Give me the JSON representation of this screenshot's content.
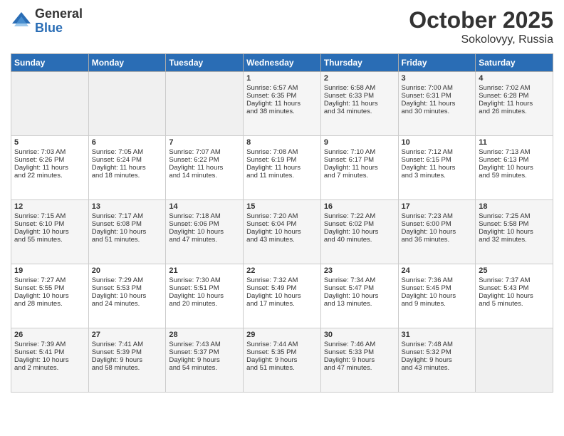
{
  "logo": {
    "general": "General",
    "blue": "Blue"
  },
  "header": {
    "month": "October 2025",
    "location": "Sokolovyy, Russia"
  },
  "weekdays": [
    "Sunday",
    "Monday",
    "Tuesday",
    "Wednesday",
    "Thursday",
    "Friday",
    "Saturday"
  ],
  "weeks": [
    [
      {
        "day": "",
        "info": ""
      },
      {
        "day": "",
        "info": ""
      },
      {
        "day": "",
        "info": ""
      },
      {
        "day": "1",
        "info": "Sunrise: 6:57 AM\nSunset: 6:35 PM\nDaylight: 11 hours\nand 38 minutes."
      },
      {
        "day": "2",
        "info": "Sunrise: 6:58 AM\nSunset: 6:33 PM\nDaylight: 11 hours\nand 34 minutes."
      },
      {
        "day": "3",
        "info": "Sunrise: 7:00 AM\nSunset: 6:31 PM\nDaylight: 11 hours\nand 30 minutes."
      },
      {
        "day": "4",
        "info": "Sunrise: 7:02 AM\nSunset: 6:28 PM\nDaylight: 11 hours\nand 26 minutes."
      }
    ],
    [
      {
        "day": "5",
        "info": "Sunrise: 7:03 AM\nSunset: 6:26 PM\nDaylight: 11 hours\nand 22 minutes."
      },
      {
        "day": "6",
        "info": "Sunrise: 7:05 AM\nSunset: 6:24 PM\nDaylight: 11 hours\nand 18 minutes."
      },
      {
        "day": "7",
        "info": "Sunrise: 7:07 AM\nSunset: 6:22 PM\nDaylight: 11 hours\nand 14 minutes."
      },
      {
        "day": "8",
        "info": "Sunrise: 7:08 AM\nSunset: 6:19 PM\nDaylight: 11 hours\nand 11 minutes."
      },
      {
        "day": "9",
        "info": "Sunrise: 7:10 AM\nSunset: 6:17 PM\nDaylight: 11 hours\nand 7 minutes."
      },
      {
        "day": "10",
        "info": "Sunrise: 7:12 AM\nSunset: 6:15 PM\nDaylight: 11 hours\nand 3 minutes."
      },
      {
        "day": "11",
        "info": "Sunrise: 7:13 AM\nSunset: 6:13 PM\nDaylight: 10 hours\nand 59 minutes."
      }
    ],
    [
      {
        "day": "12",
        "info": "Sunrise: 7:15 AM\nSunset: 6:10 PM\nDaylight: 10 hours\nand 55 minutes."
      },
      {
        "day": "13",
        "info": "Sunrise: 7:17 AM\nSunset: 6:08 PM\nDaylight: 10 hours\nand 51 minutes."
      },
      {
        "day": "14",
        "info": "Sunrise: 7:18 AM\nSunset: 6:06 PM\nDaylight: 10 hours\nand 47 minutes."
      },
      {
        "day": "15",
        "info": "Sunrise: 7:20 AM\nSunset: 6:04 PM\nDaylight: 10 hours\nand 43 minutes."
      },
      {
        "day": "16",
        "info": "Sunrise: 7:22 AM\nSunset: 6:02 PM\nDaylight: 10 hours\nand 40 minutes."
      },
      {
        "day": "17",
        "info": "Sunrise: 7:23 AM\nSunset: 6:00 PM\nDaylight: 10 hours\nand 36 minutes."
      },
      {
        "day": "18",
        "info": "Sunrise: 7:25 AM\nSunset: 5:58 PM\nDaylight: 10 hours\nand 32 minutes."
      }
    ],
    [
      {
        "day": "19",
        "info": "Sunrise: 7:27 AM\nSunset: 5:55 PM\nDaylight: 10 hours\nand 28 minutes."
      },
      {
        "day": "20",
        "info": "Sunrise: 7:29 AM\nSunset: 5:53 PM\nDaylight: 10 hours\nand 24 minutes."
      },
      {
        "day": "21",
        "info": "Sunrise: 7:30 AM\nSunset: 5:51 PM\nDaylight: 10 hours\nand 20 minutes."
      },
      {
        "day": "22",
        "info": "Sunrise: 7:32 AM\nSunset: 5:49 PM\nDaylight: 10 hours\nand 17 minutes."
      },
      {
        "day": "23",
        "info": "Sunrise: 7:34 AM\nSunset: 5:47 PM\nDaylight: 10 hours\nand 13 minutes."
      },
      {
        "day": "24",
        "info": "Sunrise: 7:36 AM\nSunset: 5:45 PM\nDaylight: 10 hours\nand 9 minutes."
      },
      {
        "day": "25",
        "info": "Sunrise: 7:37 AM\nSunset: 5:43 PM\nDaylight: 10 hours\nand 5 minutes."
      }
    ],
    [
      {
        "day": "26",
        "info": "Sunrise: 7:39 AM\nSunset: 5:41 PM\nDaylight: 10 hours\nand 2 minutes."
      },
      {
        "day": "27",
        "info": "Sunrise: 7:41 AM\nSunset: 5:39 PM\nDaylight: 9 hours\nand 58 minutes."
      },
      {
        "day": "28",
        "info": "Sunrise: 7:43 AM\nSunset: 5:37 PM\nDaylight: 9 hours\nand 54 minutes."
      },
      {
        "day": "29",
        "info": "Sunrise: 7:44 AM\nSunset: 5:35 PM\nDaylight: 9 hours\nand 51 minutes."
      },
      {
        "day": "30",
        "info": "Sunrise: 7:46 AM\nSunset: 5:33 PM\nDaylight: 9 hours\nand 47 minutes."
      },
      {
        "day": "31",
        "info": "Sunrise: 7:48 AM\nSunset: 5:32 PM\nDaylight: 9 hours\nand 43 minutes."
      },
      {
        "day": "",
        "info": ""
      }
    ]
  ]
}
